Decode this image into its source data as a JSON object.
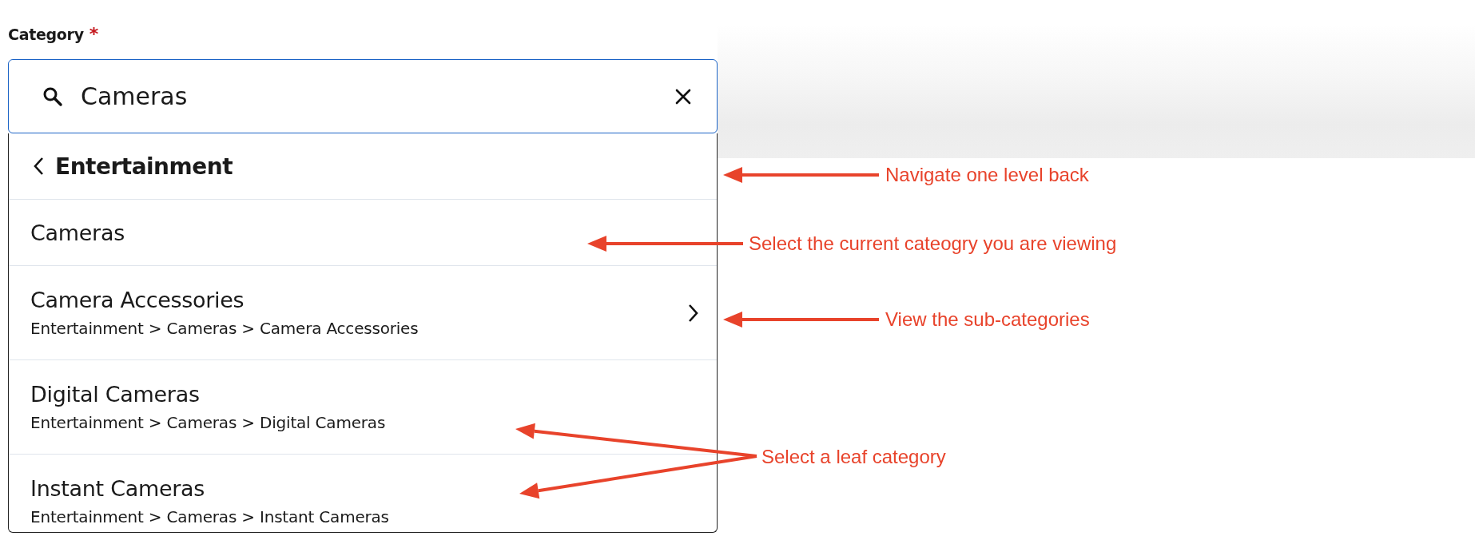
{
  "field": {
    "label": "Category",
    "required_mark": "*",
    "value": "Cameras"
  },
  "dropdown": {
    "back": {
      "label": "Entertainment"
    },
    "items": [
      {
        "kind": "current",
        "title": "Cameras"
      },
      {
        "kind": "branch",
        "title": "Camera Accessories",
        "path": "Entertainment > Cameras > Camera Accessories"
      },
      {
        "kind": "leaf",
        "title": "Digital Cameras",
        "path": "Entertainment > Cameras > Digital Cameras"
      },
      {
        "kind": "leaf",
        "title": "Instant Cameras",
        "path": "Entertainment > Cameras > Instant Cameras"
      }
    ]
  },
  "annotations": [
    {
      "text": "Navigate one level back"
    },
    {
      "text": "Select the current cateogry you are viewing"
    },
    {
      "text": "View the sub-categories"
    },
    {
      "text": "Select a leaf category"
    }
  ]
}
